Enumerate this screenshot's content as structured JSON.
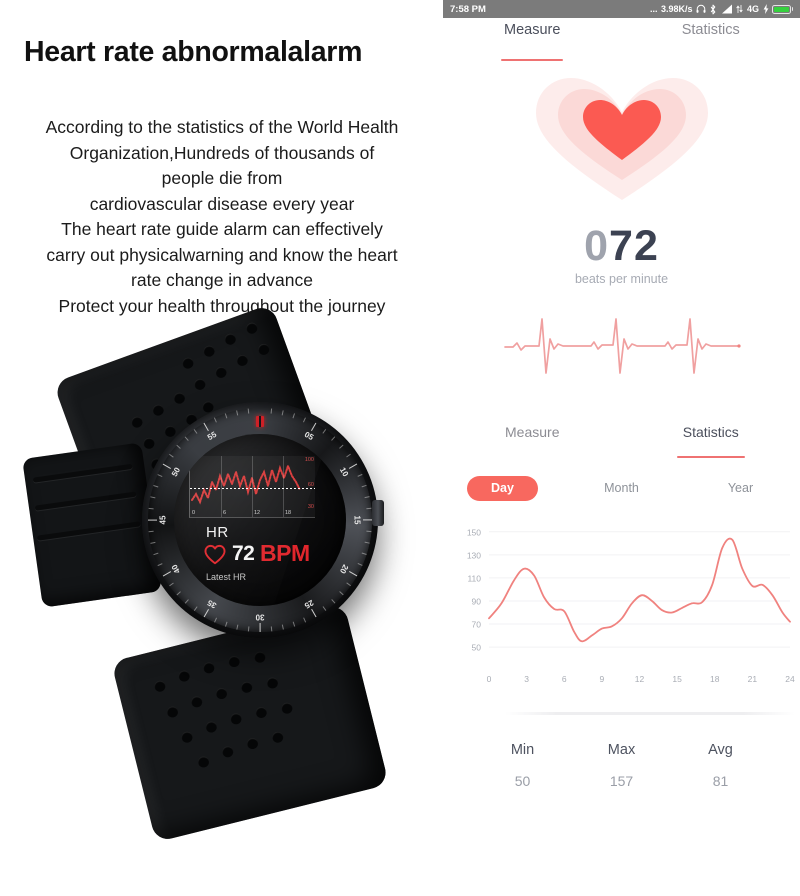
{
  "marketing": {
    "headline": "Heart rate abnormalalarm",
    "paragraph_lines": [
      "According to the statistics of the World Health",
      "Organization,Hundreds of thousands of",
      "people die from",
      "cardiovascular disease every year",
      "The heart rate guide alarm can effectively",
      "carry out physicalwarning and know the heart",
      "rate change in advance",
      "Protect your health throughout the journey"
    ]
  },
  "watch": {
    "face": {
      "hr_label": "HR",
      "value": "72",
      "unit": "BPM",
      "caption": "Latest HR",
      "mini_chart": {
        "x_ticks": [
          "0",
          "6",
          "12",
          "18"
        ],
        "y_ticks": [
          "100",
          "60",
          "30"
        ]
      }
    },
    "bezel_numbers": [
      "05",
      "10",
      "15",
      "20",
      "25",
      "30",
      "35",
      "40",
      "45",
      "50",
      "55"
    ]
  },
  "app": {
    "status_bar": {
      "time": "7:58 PM",
      "network_speed": "3.98K/s",
      "dots": "...",
      "network_type": "4G",
      "icons": [
        "headphone-icon",
        "bluetooth-icon",
        "signal-icon",
        "data-transfer-icon",
        "charging-bolt-icon",
        "battery-icon"
      ]
    },
    "top_tabs": [
      {
        "label": "Measure",
        "active": true
      },
      {
        "label": "Statistics",
        "active": false
      }
    ],
    "measure": {
      "bpm_leading": "0",
      "bpm_value": "72",
      "bpm_caption": "beats per minute"
    },
    "mid_tabs": [
      {
        "label": "Measure",
        "active": false
      },
      {
        "label": "Statistics",
        "active": true
      }
    ],
    "ranges": [
      {
        "label": "Day",
        "selected": true
      },
      {
        "label": "Month",
        "selected": false
      },
      {
        "label": "Year",
        "selected": false
      }
    ],
    "stats": [
      {
        "key": "Min",
        "value": "50"
      },
      {
        "key": "Max",
        "value": "157"
      },
      {
        "key": "Avg",
        "value": "81"
      }
    ]
  },
  "colors": {
    "accent": "#f8685f",
    "tab_underline": "#ef7272",
    "chart_line": "#f0827f",
    "heart_core": "#fb5a52",
    "bpm_dark": "#3c4252",
    "bpm_light": "#9fa3ad",
    "status_bar_bg": "#7b7b7b",
    "battery_green": "#35d13e"
  },
  "chart_data": {
    "type": "line",
    "title": "",
    "xlabel": "",
    "ylabel": "",
    "x_ticks": [
      0,
      3,
      6,
      9,
      12,
      15,
      18,
      21,
      24
    ],
    "y_ticks": [
      50,
      70,
      90,
      110,
      130,
      150
    ],
    "xlim": [
      0,
      24
    ],
    "ylim": [
      44,
      155
    ],
    "grid": true,
    "legend": "none",
    "series": [
      {
        "name": "Heart rate",
        "color": "#f0827f",
        "x": [
          0,
          1,
          2,
          2.8,
          3.6,
          4.4,
          5.2,
          6,
          6.8,
          7.4,
          8.2,
          9,
          9.8,
          10.6,
          11.4,
          12.2,
          13,
          13.8,
          14.6,
          15.4,
          16.2,
          17,
          17.8,
          18.6,
          19.4,
          20.2,
          21,
          21.8,
          22.6,
          23.4,
          24
        ],
        "y": [
          75,
          88,
          108,
          118,
          112,
          93,
          83,
          81,
          63,
          55,
          60,
          66,
          68,
          75,
          88,
          95,
          90,
          82,
          80,
          84,
          88,
          89,
          104,
          136,
          143,
          118,
          103,
          104,
          95,
          80,
          72
        ]
      }
    ]
  },
  "ecg": {
    "description": "three-beat ecg waveform",
    "color": "#f0a0a0"
  }
}
